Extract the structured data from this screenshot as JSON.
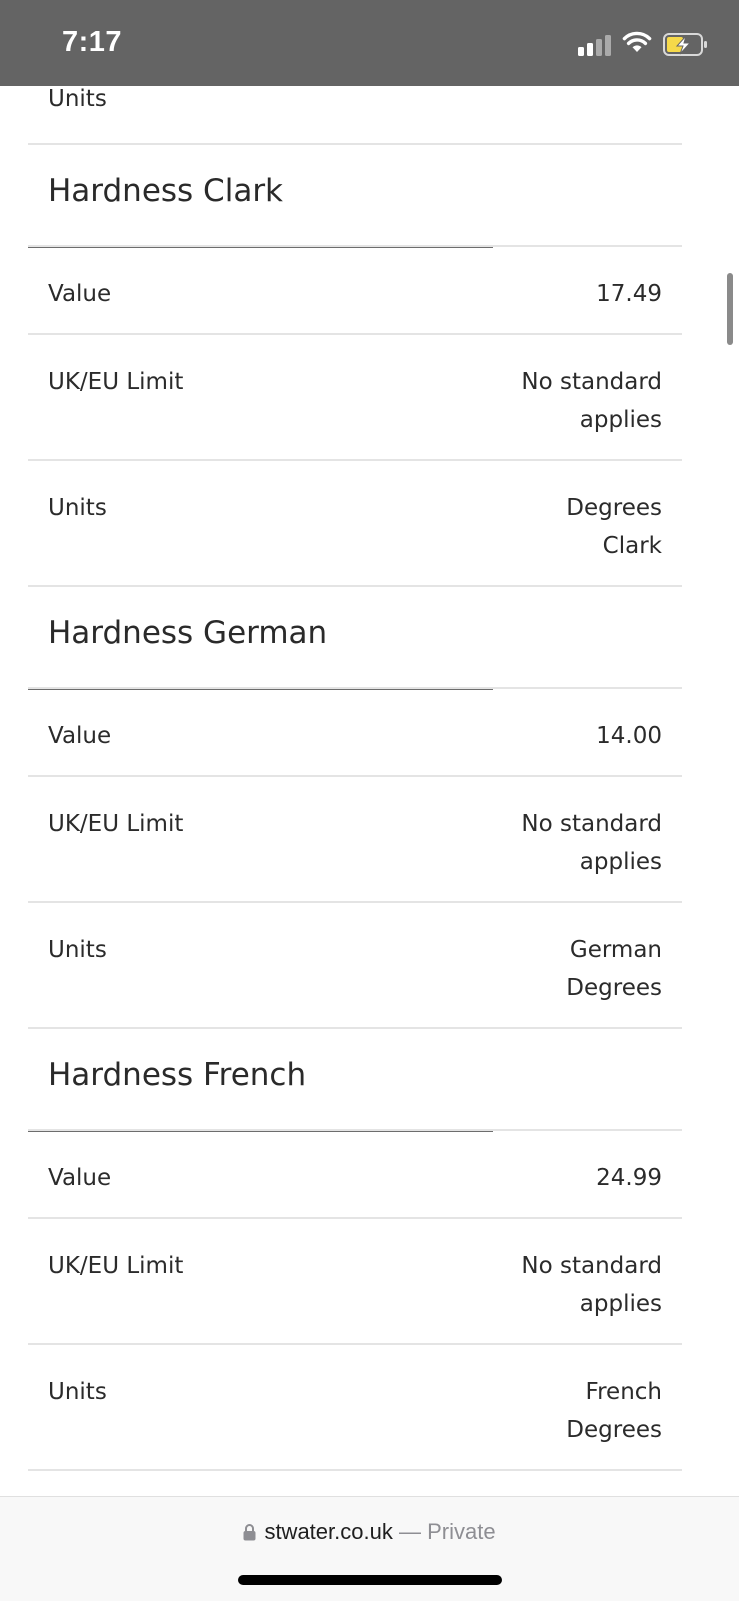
{
  "status_bar": {
    "time": "7:17"
  },
  "top_fragment": {
    "label": "Units"
  },
  "sections": [
    {
      "title": "Hardness Clark",
      "rows": [
        {
          "label": "Value",
          "value_lines": [
            "17.49"
          ]
        },
        {
          "label": "UK/EU Limit",
          "value_lines": [
            "No standard",
            "applies"
          ]
        },
        {
          "label": "Units",
          "value_lines": [
            "Degrees",
            "Clark"
          ]
        }
      ]
    },
    {
      "title": "Hardness German",
      "rows": [
        {
          "label": "Value",
          "value_lines": [
            "14.00"
          ]
        },
        {
          "label": "UK/EU Limit",
          "value_lines": [
            "No standard",
            "applies"
          ]
        },
        {
          "label": "Units",
          "value_lines": [
            "German",
            "Degrees"
          ]
        }
      ]
    },
    {
      "title": "Hardness French",
      "rows": [
        {
          "label": "Value",
          "value_lines": [
            "24.99"
          ]
        },
        {
          "label": "UK/EU Limit",
          "value_lines": [
            "No standard",
            "applies"
          ]
        },
        {
          "label": "Units",
          "value_lines": [
            "French",
            "Degrees"
          ]
        }
      ]
    }
  ],
  "url_bar": {
    "domain": "stwater.co.uk",
    "separator": "—",
    "mode": "Private"
  },
  "icons": {
    "signal": "cellular-signal-icon",
    "wifi": "wifi-icon",
    "battery": "battery-charging-icon",
    "lock": "lock-icon"
  },
  "colors": {
    "status_bar_bg": "#646464",
    "battery_fill": "#f6d94a",
    "section_rule": "#6d6d6d",
    "divider": "#e4e4e4"
  }
}
